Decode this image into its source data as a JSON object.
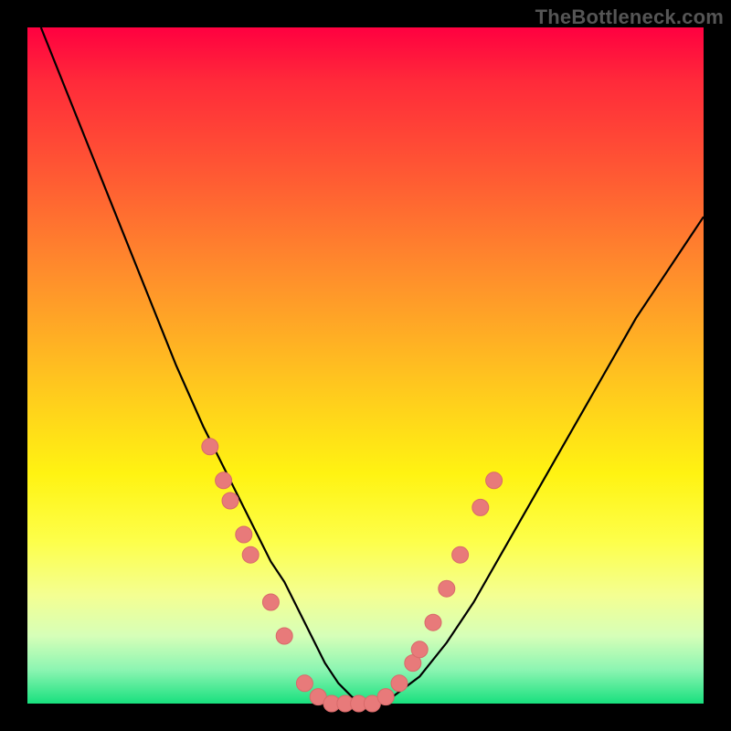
{
  "watermark": {
    "text": "TheBottleneck.com"
  },
  "chart_data": {
    "type": "line",
    "title": "",
    "xlabel": "",
    "ylabel": "",
    "xlim": [
      0,
      100
    ],
    "ylim": [
      0,
      100
    ],
    "grid": false,
    "legend": false,
    "series": [
      {
        "name": "bottleneck-curve",
        "x": [
          2,
          6,
          10,
          14,
          18,
          22,
          26,
          30,
          34,
          36,
          38,
          40,
          42,
          44,
          46,
          48,
          50,
          54,
          58,
          62,
          66,
          70,
          74,
          78,
          82,
          86,
          90,
          94,
          98,
          100
        ],
        "y": [
          100,
          90,
          80,
          70,
          60,
          50,
          41,
          33,
          25,
          21,
          18,
          14,
          10,
          6,
          3,
          1,
          0,
          1,
          4,
          9,
          15,
          22,
          29,
          36,
          43,
          50,
          57,
          63,
          69,
          72
        ]
      }
    ],
    "points": [
      {
        "name": "left-1",
        "x": 27,
        "y": 38
      },
      {
        "name": "left-2",
        "x": 29,
        "y": 33
      },
      {
        "name": "left-3",
        "x": 30,
        "y": 30
      },
      {
        "name": "left-4",
        "x": 32,
        "y": 25
      },
      {
        "name": "left-5",
        "x": 33,
        "y": 22
      },
      {
        "name": "left-6",
        "x": 36,
        "y": 15
      },
      {
        "name": "left-7",
        "x": 38,
        "y": 10
      },
      {
        "name": "bottom-1",
        "x": 41,
        "y": 3
      },
      {
        "name": "bottom-2",
        "x": 43,
        "y": 1
      },
      {
        "name": "bottom-3",
        "x": 45,
        "y": 0
      },
      {
        "name": "bottom-4",
        "x": 47,
        "y": 0
      },
      {
        "name": "bottom-5",
        "x": 49,
        "y": 0
      },
      {
        "name": "bottom-6",
        "x": 51,
        "y": 0
      },
      {
        "name": "bottom-7",
        "x": 53,
        "y": 1
      },
      {
        "name": "right-1",
        "x": 55,
        "y": 3
      },
      {
        "name": "right-2",
        "x": 57,
        "y": 6
      },
      {
        "name": "right-3",
        "x": 58,
        "y": 8
      },
      {
        "name": "right-4",
        "x": 60,
        "y": 12
      },
      {
        "name": "right-5",
        "x": 62,
        "y": 17
      },
      {
        "name": "right-6",
        "x": 64,
        "y": 22
      },
      {
        "name": "right-7",
        "x": 67,
        "y": 29
      },
      {
        "name": "right-8",
        "x": 69,
        "y": 33
      }
    ],
    "colors": {
      "curve": "#000000",
      "points": "#e87a7a",
      "gradient_top": "#ff0040",
      "gradient_bottom": "#18e07e"
    }
  }
}
